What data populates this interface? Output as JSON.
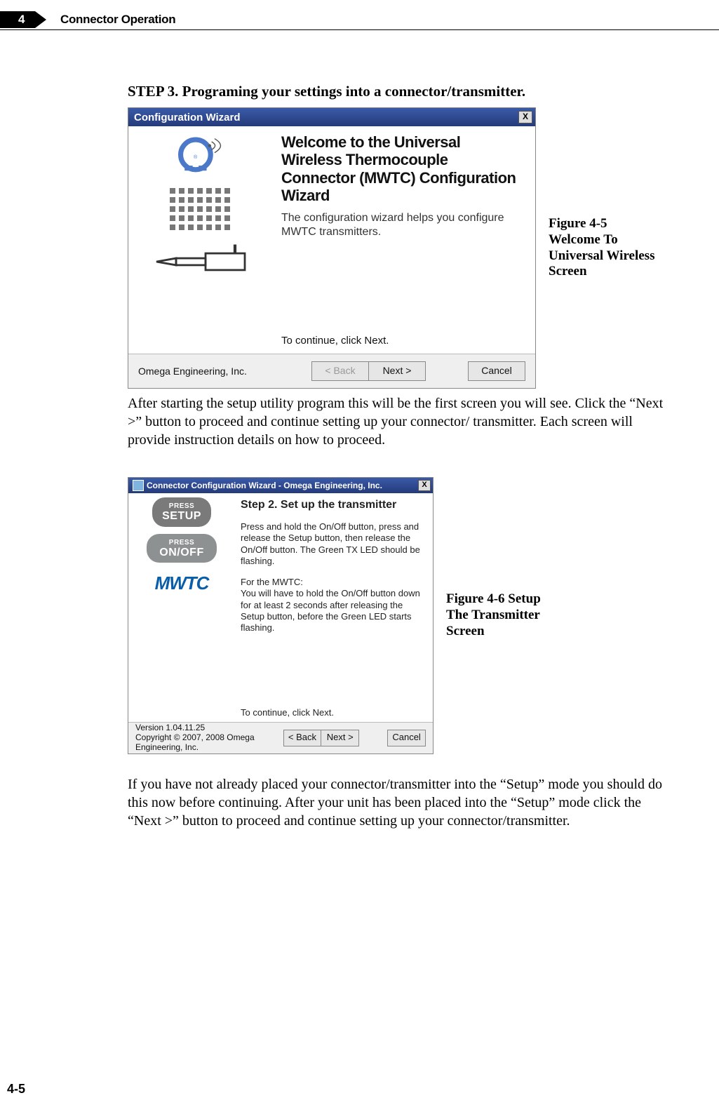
{
  "header": {
    "chapter_number": "4",
    "chapter_title": "Connector Operation"
  },
  "step_heading": "STEP 3. Programing your settings into a connector/transmitter.",
  "wizard1": {
    "title": "Configuration Wizard",
    "close_label": "X",
    "heading": "Welcome to the Universal Wireless Thermocouple Connector (MWTC) Configuration Wizard",
    "subtext": "The configuration wizard helps you configure MWTC transmitters.",
    "continue_hint": "To continue, click Next.",
    "footer_left": "Omega Engineering, Inc.",
    "btn_back": "< Back",
    "btn_next": "Next >",
    "btn_cancel": "Cancel"
  },
  "fig1_caption": "Figure 4-5 Welcome To Universal Wireless Screen",
  "para1": "After starting the setup utility program this will be the first screen you will see. Click the “Next >” button to proceed and continue setting up your connector/ transmitter. Each screen will provide instruction details on how to proceed.",
  "wizard2": {
    "title": "Connector Configuration Wizard - Omega Engineering, Inc.",
    "close_label": "X",
    "pill_setup_small": "PRESS",
    "pill_setup_big": "SETUP",
    "pill_onoff_small": "PRESS",
    "pill_onoff_big": "ON/OFF",
    "brand": "MWTC",
    "heading": "Step 2.  Set up the transmitter",
    "p1": "Press and hold the On/Off button, press and release the Setup button, then release the On/Off button.  The Green TX LED should be flashing.",
    "p2": "For the MWTC:\nYou will have to hold the On/Off button down for at least 2 seconds after releasing the Setup button, before the Green LED starts flashing.",
    "continue_hint": "To continue, click Next.",
    "version": "Version 1.04.11.25",
    "copyright": "Copyright © 2007, 2008 Omega Engineering, Inc.",
    "btn_back": "< Back",
    "btn_next": "Next >",
    "btn_cancel": "Cancel"
  },
  "fig2_caption": "Figure 4-6 Setup The Transmitter Screen",
  "para2": "If you have not already placed your connector/transmitter into the “Setup” mode you should do this now before continuing. After your unit has been placed into the “Setup” mode click the “Next >” button to proceed and continue setting up your connector/transmitter.",
  "page_number": "4-5"
}
